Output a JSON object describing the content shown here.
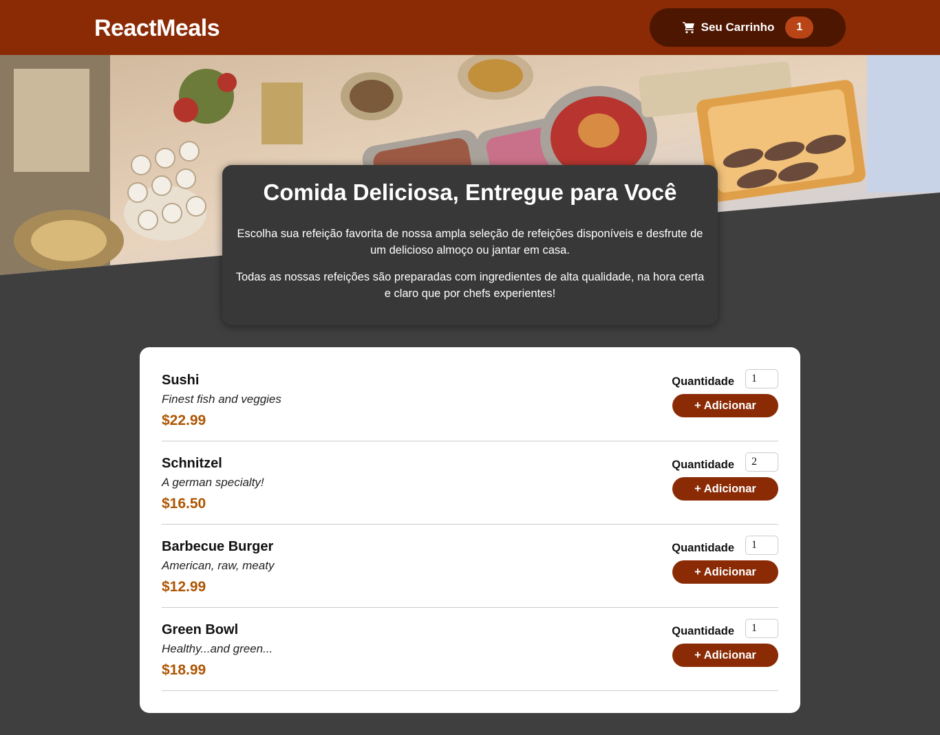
{
  "header": {
    "brand": "ReactMeals",
    "cart_label": "Seu Carrinho",
    "cart_count": "1",
    "cart_icon": "shopping-cart-icon"
  },
  "hero": {
    "image": "catering-buffet-table"
  },
  "summary": {
    "title": "Comida Deliciosa, Entregue para Você",
    "paragraph_1": "Escolha sua refeição favorita de nossa ampla seleção de refeições disponíveis e desfrute de um delicioso almoço ou jantar em casa.",
    "paragraph_2": "Todas as nossas refeições são preparadas com ingredientes de alta qualidade, na hora certa e claro que por chefs experientes!"
  },
  "meals": [
    {
      "name": "Sushi",
      "description": "Finest fish and veggies",
      "price": "$22.99",
      "quantity_label": "Quantidade",
      "quantity": "1",
      "add_label": "+ Adicionar"
    },
    {
      "name": "Schnitzel",
      "description": "A german specialty!",
      "price": "$16.50",
      "quantity_label": "Quantidade",
      "quantity": "2",
      "add_label": "+ Adicionar"
    },
    {
      "name": "Barbecue Burger",
      "description": "American, raw, meaty",
      "price": "$12.99",
      "quantity_label": "Quantidade",
      "quantity": "1",
      "add_label": "+ Adicionar"
    },
    {
      "name": "Green Bowl",
      "description": "Healthy...and green...",
      "price": "$18.99",
      "quantity_label": "Quantidade",
      "quantity": "1",
      "add_label": "+ Adicionar"
    }
  ],
  "colors": {
    "header_bg": "#8a2b06",
    "cart_button_bg": "#4d1601",
    "cart_badge_bg": "#b94517",
    "page_bg": "#3f3f3f",
    "summary_bg": "#383838",
    "price": "#ad5502",
    "add_button_bg": "#8a2b06"
  }
}
